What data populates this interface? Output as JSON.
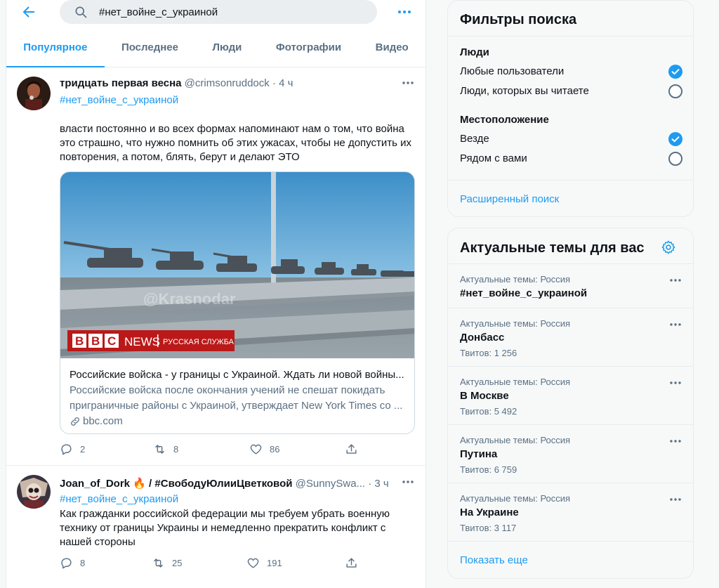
{
  "search": {
    "query": "#нет_войне_с_украиной"
  },
  "tabs": [
    "Популярное",
    "Последнее",
    "Люди",
    "Фотографии",
    "Видео"
  ],
  "tweets": [
    {
      "name": "тридцать первая весна",
      "handle": "@crimsonruddock",
      "time": "· 4 ч",
      "hashtag": "#нет_войне_с_украиной",
      "text": "власти постоянно и во всех формах напоминают нам о том, что война это страшно, что нужно помнить об этих ужасах, чтобы не допустить их повторения, а потом, блять, берут и делают ЭТО",
      "card": {
        "bbc_letters": [
          "B",
          "B",
          "C"
        ],
        "bbc_news": "NEWS",
        "bbc_service": "РУССКАЯ СЛУЖБА",
        "watermark": "@Krasnodar",
        "title": "Российские войска - у границы с Украиной. Ждать ли новой войны...",
        "description": "Российские войска после окончания учений не спешат покидать приграничные районы с Украиной, утверждает New York Times со ...",
        "domain": "bbc.com"
      },
      "replies": "2",
      "retweets": "8",
      "likes": "86"
    },
    {
      "name": "Joan_of_Dork",
      "name_emoji": "🔥",
      "name_suffix": " / #СвободуЮлииЦветковой",
      "handle": "@SunnySwa...",
      "time": "· 3 ч",
      "hashtag": "#нет_войне_с_украиной",
      "text": "Как гражданки российской федерации мы требуем убрать военную технику от границы Украины и немедленно прекратить конфликт с нашей стороны",
      "replies": "8",
      "retweets": "25",
      "likes": "191"
    }
  ],
  "filters": {
    "title": "Фильтры поиска",
    "people_label": "Люди",
    "people_options": [
      {
        "label": "Любые пользователи",
        "selected": true
      },
      {
        "label": "Люди, которых вы читаете",
        "selected": false
      }
    ],
    "location_label": "Местоположение",
    "location_options": [
      {
        "label": "Везде",
        "selected": true
      },
      {
        "label": "Рядом с вами",
        "selected": false
      }
    ],
    "advanced_link": "Расширенный поиск"
  },
  "trends": {
    "title": "Актуальные темы для вас",
    "items": [
      {
        "context": "Актуальные темы: Россия",
        "name": "#нет_войне_с_украиной",
        "count": ""
      },
      {
        "context": "Актуальные темы: Россия",
        "name": "Донбасс",
        "count": "Твитов: 1 256"
      },
      {
        "context": "Актуальные темы: Россия",
        "name": "В Москве",
        "count": "Твитов: 5 492"
      },
      {
        "context": "Актуальные темы: Россия",
        "name": "Путина",
        "count": "Твитов: 6 759"
      },
      {
        "context": "Актуальные темы: Россия",
        "name": "На Украине",
        "count": "Твитов: 3 117"
      }
    ],
    "show_more": "Показать еще"
  },
  "colors": {
    "accent": "#1d9bf0",
    "secondary_text": "#5b7083",
    "bbc_red": "#bb1919"
  }
}
